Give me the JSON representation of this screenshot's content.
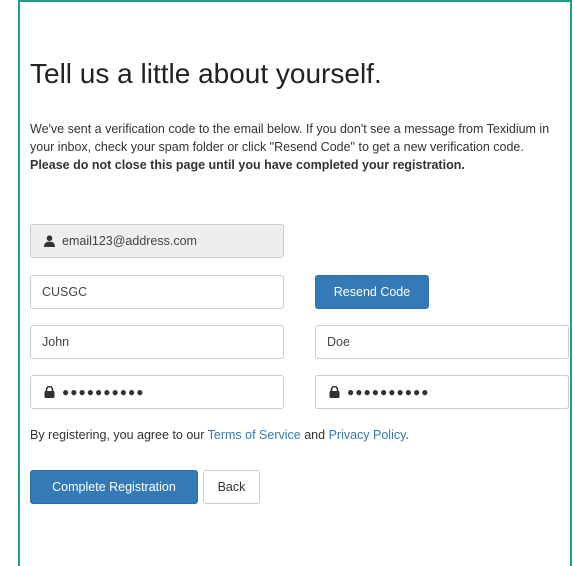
{
  "page": {
    "title": "Tell us a little about yourself.",
    "intro_text": "We've sent a verification code to the email below. If you don't see a message from Texidium in your inbox, check your spam folder or click \"Resend Code\" to get a new verification code. ",
    "intro_bold": "Please do not close this page until you have completed your registration."
  },
  "form": {
    "email": "email123@address.com",
    "verification_code": "CUSGC",
    "resend_label": "Resend Code",
    "first_name": "John",
    "last_name": "Doe",
    "password_mask": "●●●●●●●●●●",
    "confirm_password_mask": "●●●●●●●●●●"
  },
  "terms": {
    "prefix": "By registering, you agree to our ",
    "tos_label": "Terms of Service",
    "and_text": " and ",
    "privacy_label": "Privacy Policy",
    "suffix": "."
  },
  "actions": {
    "complete_label": "Complete Registration",
    "back_label": "Back"
  },
  "colors": {
    "accent": "#337ab7",
    "frame": "#1f9d8c"
  }
}
